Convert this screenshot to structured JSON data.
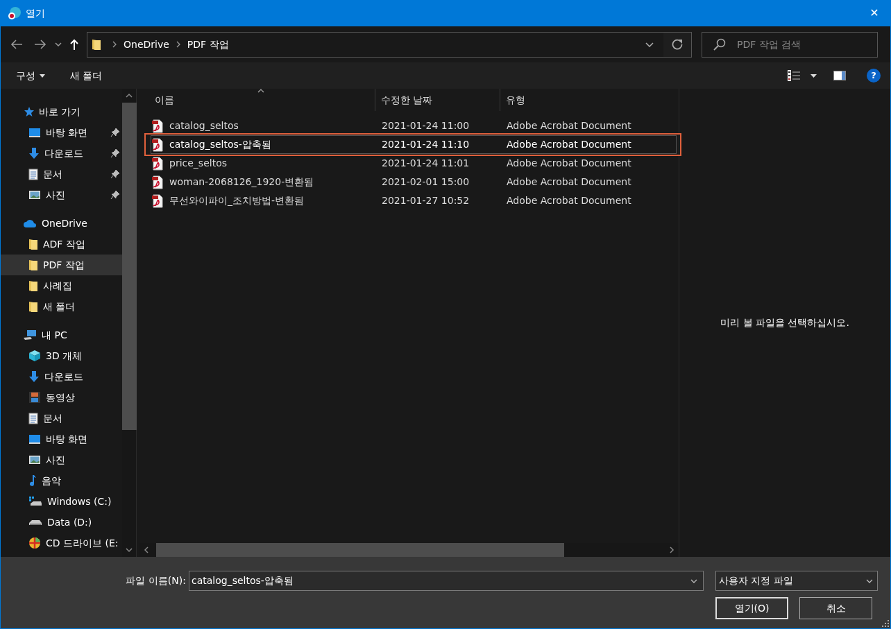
{
  "window": {
    "title": "열기",
    "close": "✕"
  },
  "address": {
    "path": [
      {
        "label": "OneDrive"
      },
      {
        "label": "PDF 작업"
      }
    ]
  },
  "search": {
    "placeholder": "PDF 작업 검색"
  },
  "toolbar": {
    "organize": "구성",
    "new_folder": "새 폴더",
    "help": "?"
  },
  "sidebar": {
    "items": [
      {
        "label": "바로 가기",
        "kind": "star",
        "pinned": false,
        "selected": false,
        "children": [
          {
            "label": "바탕 화면",
            "kind": "desktop",
            "pinned": true,
            "selected": false
          },
          {
            "label": "다운로드",
            "kind": "download",
            "pinned": true,
            "selected": false
          },
          {
            "label": "문서",
            "kind": "document",
            "pinned": true,
            "selected": false
          },
          {
            "label": "사진",
            "kind": "image",
            "pinned": true,
            "selected": false
          }
        ]
      },
      {
        "label": "OneDrive",
        "kind": "cloud",
        "pinned": false,
        "selected": false,
        "children": [
          {
            "label": "ADF 작업",
            "kind": "folder",
            "pinned": false,
            "selected": false
          },
          {
            "label": "PDF 작업",
            "kind": "folder",
            "pinned": false,
            "selected": true
          },
          {
            "label": "사례집",
            "kind": "folder",
            "pinned": false,
            "selected": false
          },
          {
            "label": "새 폴더",
            "kind": "folder",
            "pinned": false,
            "selected": false
          }
        ]
      },
      {
        "label": "내 PC",
        "kind": "computer",
        "pinned": false,
        "selected": false,
        "children": [
          {
            "label": "3D 개체",
            "kind": "cube",
            "pinned": false,
            "selected": false
          },
          {
            "label": "다운로드",
            "kind": "download",
            "pinned": false,
            "selected": false
          },
          {
            "label": "동영상",
            "kind": "film",
            "pinned": false,
            "selected": false
          },
          {
            "label": "문서",
            "kind": "document",
            "pinned": false,
            "selected": false
          },
          {
            "label": "바탕 화면",
            "kind": "desktop",
            "pinned": false,
            "selected": false
          },
          {
            "label": "사진",
            "kind": "image",
            "pinned": false,
            "selected": false
          },
          {
            "label": "음악",
            "kind": "music",
            "pinned": false,
            "selected": false
          },
          {
            "label": "Windows (C:)",
            "kind": "windrive",
            "pinned": false,
            "selected": false
          },
          {
            "label": "Data (D:)",
            "kind": "drive",
            "pinned": false,
            "selected": false
          },
          {
            "label": "CD 드라이브 (E:",
            "kind": "disc",
            "pinned": false,
            "selected": false
          }
        ]
      }
    ]
  },
  "columns": [
    {
      "label": "이름",
      "sorted": true
    },
    {
      "label": "수정한 날짜",
      "sorted": false
    },
    {
      "label": "유형",
      "sorted": false
    }
  ],
  "files": [
    {
      "name": "catalog_seltos",
      "modified": "2021-01-24 11:00",
      "type": "Adobe Acrobat Document",
      "selected": false,
      "marked": false
    },
    {
      "name": "catalog_seltos-압축됨",
      "modified": "2021-01-24 11:10",
      "type": "Adobe Acrobat Document",
      "selected": true,
      "marked": true
    },
    {
      "name": "price_seltos",
      "modified": "2021-01-24 11:01",
      "type": "Adobe Acrobat Document",
      "selected": false,
      "marked": false
    },
    {
      "name": "woman-2068126_1920-변환됨",
      "modified": "2021-02-01 15:00",
      "type": "Adobe Acrobat Document",
      "selected": false,
      "marked": false
    },
    {
      "name": "무선와이파이_조치방법-변환됨",
      "modified": "2021-01-27 10:52",
      "type": "Adobe Acrobat Document",
      "selected": false,
      "marked": false
    }
  ],
  "preview": {
    "message": "미리 볼 파일을 선택하십시오."
  },
  "footer": {
    "filename_label": "파일 이름(N):",
    "filename": "catalog_seltos-압축됨",
    "filter": "사용자 지정 파일",
    "open": "열기(O)",
    "cancel": "취소"
  }
}
